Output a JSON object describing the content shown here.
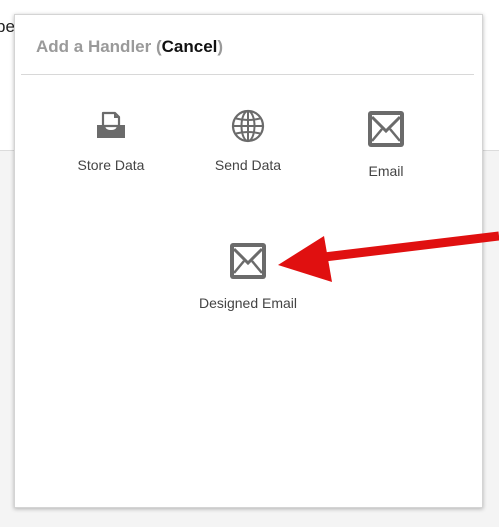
{
  "background": {
    "partial_text": "pe"
  },
  "panel": {
    "title": "Add a Handler",
    "open_paren": "(",
    "cancel_label": "Cancel",
    "close_paren": ")"
  },
  "handlers": [
    {
      "label": "Store Data",
      "icon": "inbox-tray-icon"
    },
    {
      "label": "Send Data",
      "icon": "globe-icon"
    },
    {
      "label": "Email",
      "icon": "envelope-icon"
    },
    {
      "label": "Designed Email",
      "icon": "envelope-icon"
    }
  ],
  "colors": {
    "icon": "#6b6b6b",
    "arrow": "#e01010",
    "title": "#9a9a9a",
    "cancel": "#111111"
  }
}
